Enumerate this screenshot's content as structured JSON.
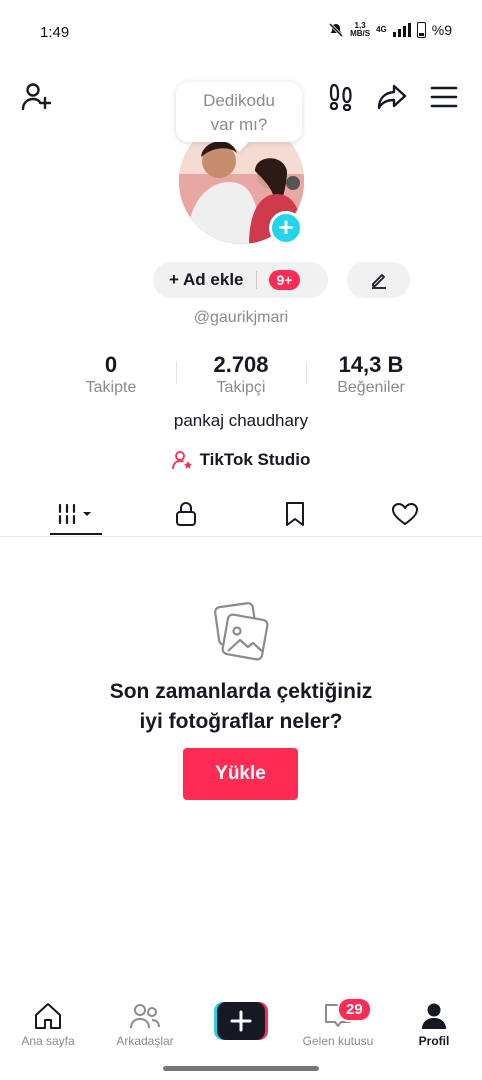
{
  "status_bar": {
    "time": "1:49",
    "net_speed_value": "1,3",
    "net_speed_unit": "MB/S",
    "net_type": "4G",
    "battery": "%9"
  },
  "header": {
    "bubble_line1": "Dedikodu",
    "bubble_line2": "var mı?"
  },
  "profile": {
    "ad_label": "+ Ad ekle",
    "ad_badge": "9+",
    "handle": "@gaurikjmari",
    "stats": [
      {
        "value": "0",
        "label": "Takipte"
      },
      {
        "value": "2.708",
        "label": "Takipçi"
      },
      {
        "value": "14,3 B",
        "label": "Beğeniler"
      }
    ],
    "bio": "pankaj chaudhary",
    "studio_label": "TikTok Studio"
  },
  "empty_state": {
    "title_line1": "Son zamanlarda çektiğiniz",
    "title_line2": "iyi fotoğraflar neler?",
    "upload_label": "Yükle"
  },
  "bottom_nav": {
    "home": "Ana sayfa",
    "friends": "Arkadaşlar",
    "inbox": "Gelen kutusu",
    "inbox_badge": "29",
    "profile": "Profil"
  },
  "colors": {
    "accent": "#fe2c55",
    "cyan": "#20d5ec",
    "text": "#161823",
    "muted": "#8a8b91"
  }
}
